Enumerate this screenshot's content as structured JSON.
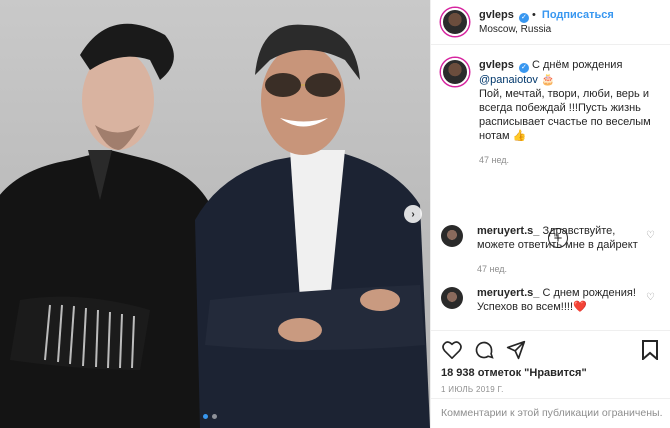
{
  "header": {
    "username": "gvleps",
    "follow_label": "Подписаться",
    "location": "Moscow, Russia"
  },
  "caption": {
    "username": "gvleps",
    "text_start": "С днём рождения",
    "mention": "@panaiotov",
    "emoji": "🎂",
    "text_rest": "Пой, мечтай, твори, люби, верь и всегда побеждай !!!Пусть жизнь расписывает счастье по веселым нотам 👍",
    "time": "47 нед."
  },
  "comments": [
    {
      "username": "meruyert.s_",
      "text": "Здравствуйте, можете ответить мне в дайрект",
      "time": "47 нед."
    },
    {
      "username": "meruyert.s_",
      "text": "С днем рождения! Успехов во всем!!!!❤️"
    }
  ],
  "actions": {
    "likes": "18 938 отметок \"Нравится\"",
    "date": "1 ИЮЛЬ 2019 Г."
  },
  "footer": {
    "text": "Комментарии к этой публикации ограничены."
  },
  "colors": {
    "accent": "#3897f0",
    "heart": "#ed4956",
    "muted": "#8e8e8e"
  },
  "icons": [
    "verified-icon",
    "plus-circle-icon",
    "heart-icon",
    "comment-icon",
    "share-icon",
    "bookmark-icon",
    "next-arrow-icon"
  ]
}
